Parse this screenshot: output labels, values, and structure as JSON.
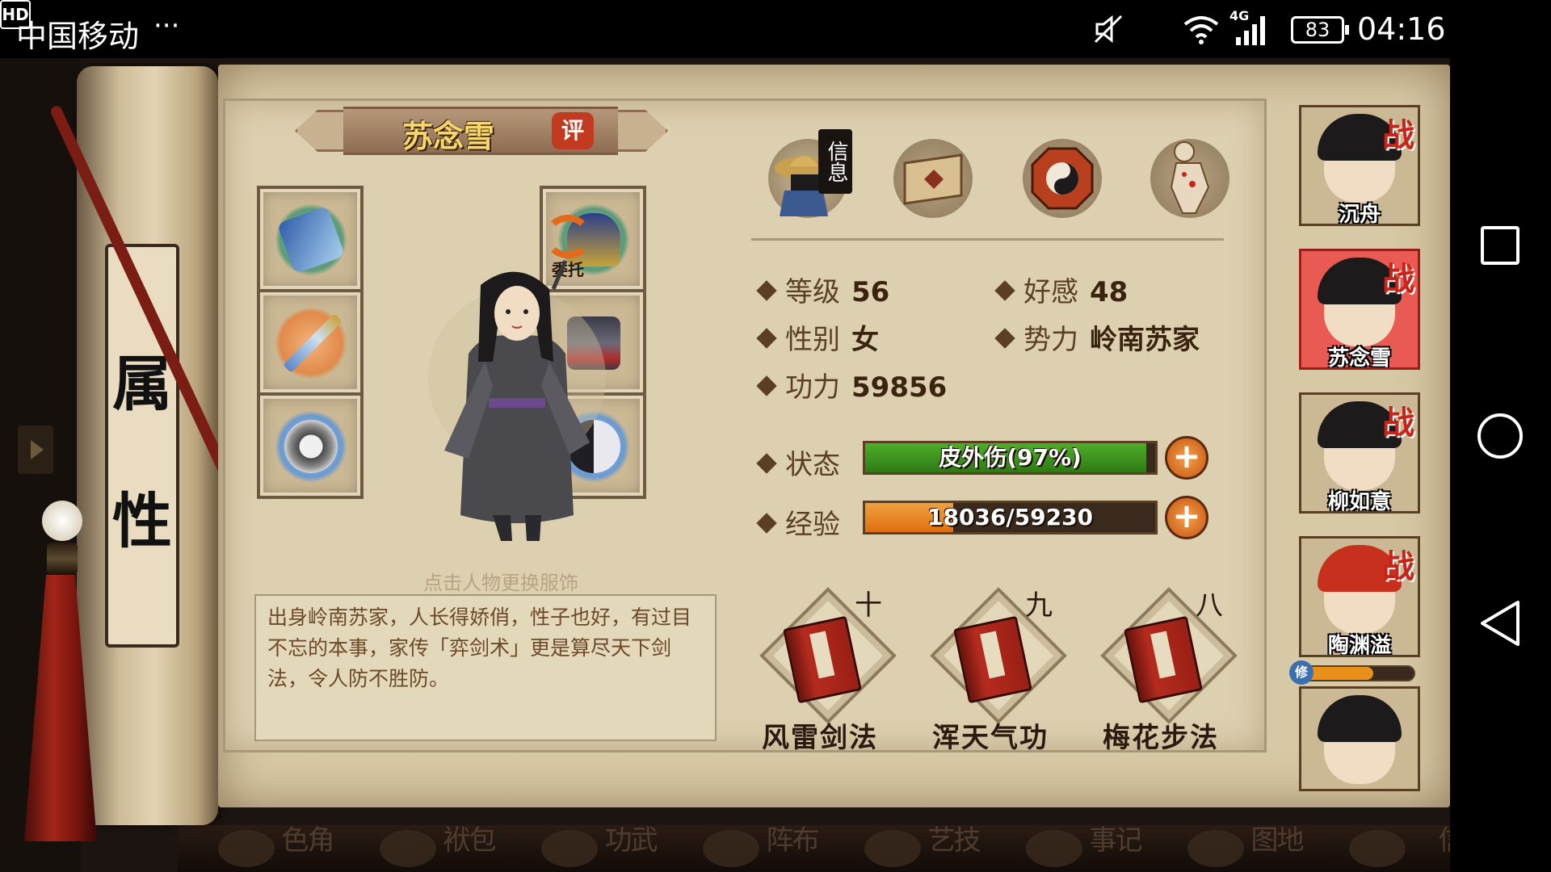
{
  "status_bar": {
    "carrier": "中国移动",
    "more": "···",
    "hd": "HD",
    "network": "4G",
    "battery": "83",
    "time": "04:16"
  },
  "character": {
    "name": "苏念雪",
    "review_label": "评",
    "delegate_label": "委托",
    "change_outfit_hint": "点击人物更换服饰",
    "bio": "出身岭南苏家，人长得娇俏，性子也好，有过目不忘的本事，家传「弈剑术」更是算尽天下剑法，令人防不胜防。"
  },
  "sidebar_label": [
    "属",
    "性"
  ],
  "tabs": {
    "info_label": "信息"
  },
  "stats": {
    "level_label": "等级",
    "level": "56",
    "affinity_label": "好感",
    "affinity": "48",
    "gender_label": "性别",
    "gender": "女",
    "faction_label": "势力",
    "faction": "岭南苏家",
    "power_label": "功力",
    "power": "59856"
  },
  "status": {
    "label": "状态",
    "text": "皮外伤(97%)",
    "fraction": 0.97
  },
  "experience": {
    "label": "经验",
    "text": "18036/59230",
    "fraction": 0.3045
  },
  "skills": [
    {
      "level": "十",
      "name": "风雷剑法"
    },
    {
      "level": "九",
      "name": "浑天气功"
    },
    {
      "level": "八",
      "name": "梅花步法"
    }
  ],
  "party": [
    {
      "name": "沉舟",
      "battle": "战"
    },
    {
      "name": "苏念雪",
      "battle": "战"
    },
    {
      "name": "柳如意",
      "battle": "战"
    },
    {
      "name": "陶渊溢",
      "battle": "战"
    }
  ],
  "cultivate": {
    "label": "修",
    "fraction": 0.65
  },
  "bottom_menu": [
    "角色",
    "包袱",
    "武功",
    "布阵",
    "技艺",
    "记事",
    "地图",
    "信"
  ],
  "colors": {
    "status_fill": "#4fae2a",
    "exp_fill": "#e07010",
    "accent_red": "#c23a1f",
    "parchment": "#d8c9a6"
  }
}
